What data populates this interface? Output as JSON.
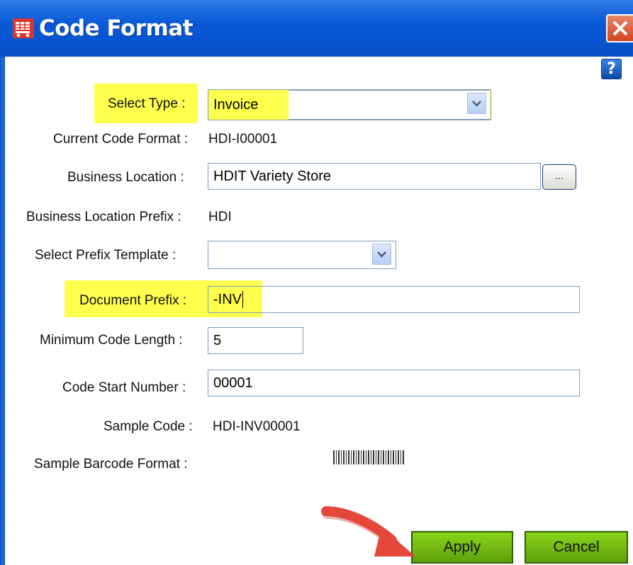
{
  "window": {
    "title": "Code Format",
    "title_icon": "shopping-cart-icon",
    "close_icon": "close-icon",
    "help_label": "?"
  },
  "form": {
    "select_type": {
      "label": "Select Type :",
      "value": "Invoice"
    },
    "current_code_format": {
      "label": "Current Code Format :",
      "value": "HDI-I00001"
    },
    "business_location": {
      "label": "Business Location :",
      "value": "HDIT Variety Store",
      "browse_label": "..."
    },
    "business_location_prefix": {
      "label": "Business Location Prefix :",
      "value": "HDI"
    },
    "select_prefix_template": {
      "label": "Select Prefix Template  :",
      "value": ""
    },
    "document_prefix": {
      "label": "Document Prefix :",
      "value": "-INV"
    },
    "minimum_code_length": {
      "label": "Minimum Code Length :",
      "value": "5"
    },
    "code_start_number": {
      "label": "Code Start Number :",
      "value": "00001"
    },
    "sample_code": {
      "label": "Sample Code :",
      "value": "HDI-INV00001"
    },
    "sample_barcode_format": {
      "label": "Sample Barcode Format :"
    }
  },
  "buttons": {
    "apply": "Apply",
    "cancel": "Cancel"
  },
  "colors": {
    "title_bar": "#0554d2",
    "highlight": "#ffff4d",
    "button_green": "#6cb012",
    "annotation_arrow": "#e5473a"
  }
}
